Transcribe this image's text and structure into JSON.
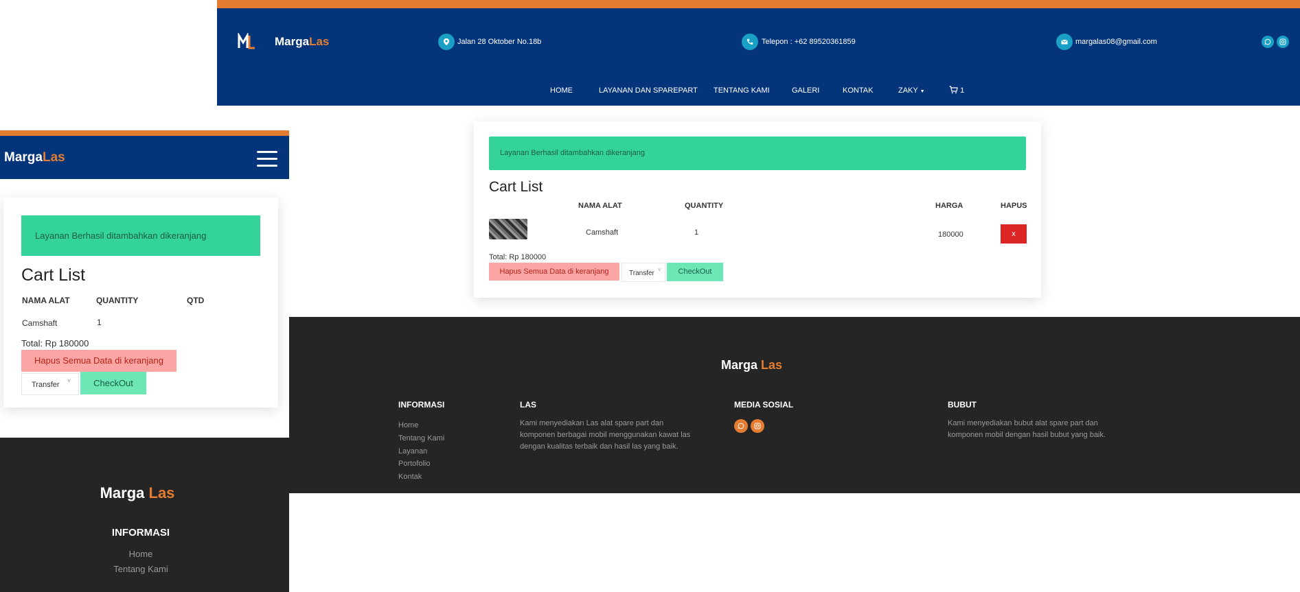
{
  "brand": {
    "marga": "Marga",
    "las": "Las",
    "logo_letters": "ML"
  },
  "topbar": {
    "address": "Jalan 28 Oktober No.18b",
    "phone": "Telepon : +62 89520361859",
    "email": "margalas08@gmail.com"
  },
  "nav": {
    "items": [
      "HOME",
      "LAYANAN DAN SPAREPART",
      "TENTANG KAMI",
      "GALERI",
      "KONTAK",
      "ZAKY"
    ],
    "cart_count": "1"
  },
  "alert": "Layanan Berhasil ditambahkan dikeranjang",
  "cart": {
    "title": "Cart List",
    "headers": {
      "nama": "NAMA ALAT",
      "quantity": "QUANTITY",
      "harga": "HARGA",
      "hapus": "HAPUS",
      "qtd": "QTD"
    },
    "row": {
      "nama": "Camshaft",
      "quantity": "1",
      "harga": "180000",
      "hapus": "x"
    },
    "total": "Total: Rp 180000",
    "clear_button": "Hapus Semua Data di keranjang",
    "payment_selected": "Transfer",
    "checkout_button": "CheckOut"
  },
  "footer": {
    "brand_marga": "Marga",
    "brand_las": "Las",
    "informasi": {
      "title": "INFORMASI",
      "links": [
        "Home",
        "Tentang Kami",
        "Layanan",
        "Portofolio",
        "Kontak"
      ]
    },
    "las": {
      "title": "LAS",
      "text": "Kami menyediakan Las alat spare part dan komponen berbagai mobil menggunakan kawat las dengan kualitas terbaik dan hasil las yang baik."
    },
    "media": {
      "title": "MEDIA SOSIAL"
    },
    "bubut": {
      "title": "BUBUT",
      "text": "Kami menyediakan bubut alat spare part dan komponen mobil dengan hasil bubut yang baik."
    }
  },
  "colors": {
    "navy": "#04357a",
    "orange": "#e47d31",
    "green": "#34d399",
    "footer": "#252525",
    "danger": "#dc2626"
  },
  "icons": [
    "map-pin-icon",
    "phone-icon",
    "mail-icon",
    "whatsapp-icon",
    "instagram-icon",
    "cart-icon",
    "hamburger-icon",
    "chevron-down-icon"
  ]
}
